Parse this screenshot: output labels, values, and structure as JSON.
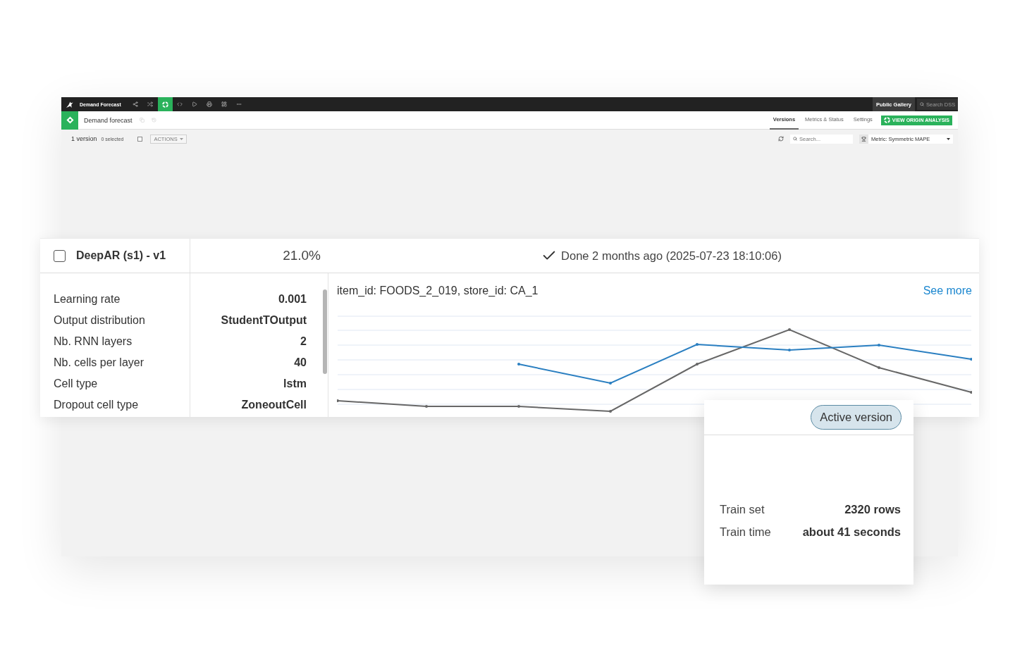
{
  "top_bar": {
    "project_title": "Demand Forecast",
    "tools": [
      {
        "kind": "flow",
        "selected": false
      },
      {
        "kind": "recipes",
        "selected": false
      },
      {
        "kind": "lab",
        "selected": true
      },
      {
        "kind": "code",
        "selected": false
      },
      {
        "kind": "jobs",
        "selected": false
      },
      {
        "kind": "print",
        "selected": false
      },
      {
        "kind": "dashboards",
        "selected": false
      },
      {
        "kind": "more",
        "selected": false
      }
    ],
    "gallery_button": "Public Gallery",
    "search": {
      "placeholder": "Search DSS"
    }
  },
  "object_bar": {
    "title": "Demand forecast",
    "tabs": [
      {
        "label": "Versions",
        "selected": true
      },
      {
        "label": "Metrics & Status",
        "selected": false
      },
      {
        "label": "Settings",
        "selected": false
      }
    ],
    "origin_button": "VIEW ORIGIN ANALYSIS"
  },
  "versions_toolbar": {
    "count": "1 version",
    "selected_count": "0 selected",
    "select_all": {
      "checked": false
    },
    "actions": {
      "label": "ACTIONS",
      "disabled": true
    },
    "search": {
      "placeholder": "Search..."
    },
    "metric": "Metric: Symmetric MAPE"
  },
  "version_card": {
    "checked": false,
    "name": "DeepAR (s1) - v1",
    "score": "21.0%",
    "status": "Done 2 months ago (2025-07-23 18:10:06)",
    "params": [
      {
        "label": "Learning rate",
        "value": "0.001"
      },
      {
        "label": "Output distribution",
        "value": "StudentTOutput"
      },
      {
        "label": "Nb. RNN layers",
        "value": "2"
      },
      {
        "label": "Nb. cells per layer",
        "value": "40"
      },
      {
        "label": "Cell type",
        "value": "lstm"
      },
      {
        "label": "Dropout cell type",
        "value": "ZoneoutCell"
      }
    ],
    "chart": {
      "title": "item_id: FOODS_2_019, store_id: CA_1",
      "link": "See more"
    }
  },
  "details_popup": {
    "badge": "Active version",
    "rows": [
      {
        "label": "Train set",
        "value": "2320 rows"
      },
      {
        "label": "Train time",
        "value": "about 41 seconds"
      }
    ]
  }
}
